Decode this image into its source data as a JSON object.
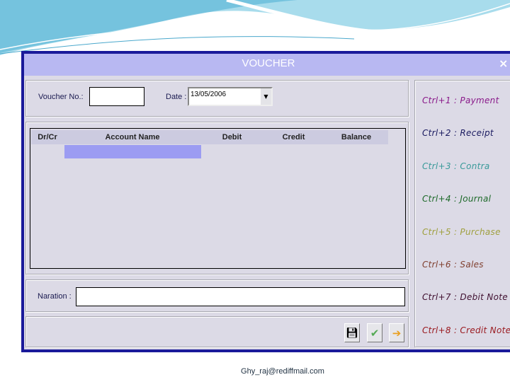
{
  "window": {
    "title": "VOUCHER",
    "close_label": "×"
  },
  "form": {
    "voucher_no_label": "Voucher No.:",
    "voucher_no_value": "",
    "date_label": "Date :",
    "date_value": "13/05/2006"
  },
  "grid": {
    "columns": [
      "Dr/Cr",
      "Account Name",
      "Debit",
      "Credit",
      "Balance"
    ]
  },
  "narration": {
    "label": "Naration :",
    "value": ""
  },
  "buttons": {
    "save_icon": "floppy-disk-icon",
    "ok_icon": "checkmark-icon",
    "next_icon": "arrow-right-icon"
  },
  "shortcuts": [
    {
      "label": "Ctrl+1 : Payment",
      "color": "#8a1a8a"
    },
    {
      "label": "Ctrl+2 : Receipt",
      "color": "#1a1a60"
    },
    {
      "label": "Ctrl+3 : Contra",
      "color": "#3a9a9a"
    },
    {
      "label": "Ctrl+4 : Journal",
      "color": "#1e6a2a"
    },
    {
      "label": "Ctrl+5 : Purchase",
      "color": "#a0a040"
    },
    {
      "label": "Ctrl+6 : Sales",
      "color": "#804030"
    },
    {
      "label": "Ctrl+7 : Debit Note",
      "color": "#401030"
    },
    {
      "label": "Ctrl+8 : Credit Note",
      "color": "#9a1a20"
    }
  ],
  "footer": {
    "email": "Ghy_raj@rediffmail.com"
  }
}
